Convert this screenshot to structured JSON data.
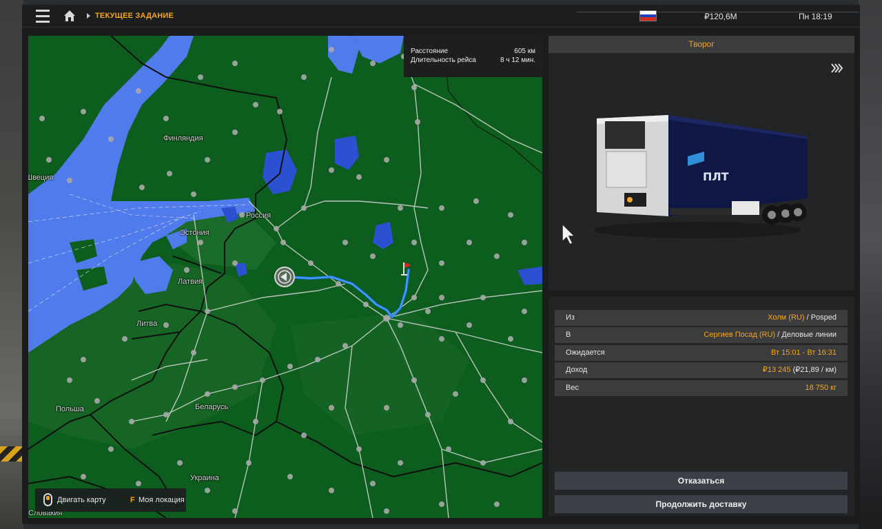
{
  "topbar": {
    "breadcrumb": "ТЕКУЩЕЕ ЗАДАНИЕ",
    "money": "₽120,6M",
    "clock": "Пн 18:19",
    "flag_colors": [
      "#ffffff",
      "#1c3fbf",
      "#d52b1e"
    ]
  },
  "map": {
    "route_info": {
      "distance_label": "Расстояние",
      "distance_value": "605 км",
      "duration_label": "Длительность рейса",
      "duration_value": "8 ч 12 мин."
    },
    "labels": {
      "finland": "Финляндия",
      "sweden": "Швеция",
      "estonia": "Эстония",
      "russia": "Россия",
      "latvia": "Латвия",
      "lithuania": "Литва",
      "belarus": "Беларусь",
      "poland": "Польша",
      "ukraine": "Украина",
      "slovakia": "Словакия"
    },
    "controls": {
      "move_map": "Двигать карту",
      "key_f": "F",
      "my_location": "Моя локация"
    },
    "colors": {
      "land": "#0d5d1f",
      "water": "#4f7bec",
      "route": "#3a8ee6",
      "border": "#101010"
    }
  },
  "cargo": {
    "name": "Творог",
    "trailer_brand": "ПЛТ"
  },
  "details": {
    "from_label": "Из",
    "from_city": "Холм (RU)",
    "from_company": "Posped",
    "to_label": "В",
    "to_city": "Сергиев Посад (RU)",
    "to_company": "Деловые линии",
    "expected_label": "Ожидается",
    "expected_value": "Вт 15:01 - Вт 16:31",
    "income_label": "Доход",
    "income_value": "₽13 245",
    "income_rate": "(₽21,89 / км)",
    "weight_label": "Вес",
    "weight_value": "18 750 кг"
  },
  "actions": {
    "cancel": "Отказаться",
    "continue": "Продолжить доставку"
  },
  "accent_color": "#f5a623"
}
